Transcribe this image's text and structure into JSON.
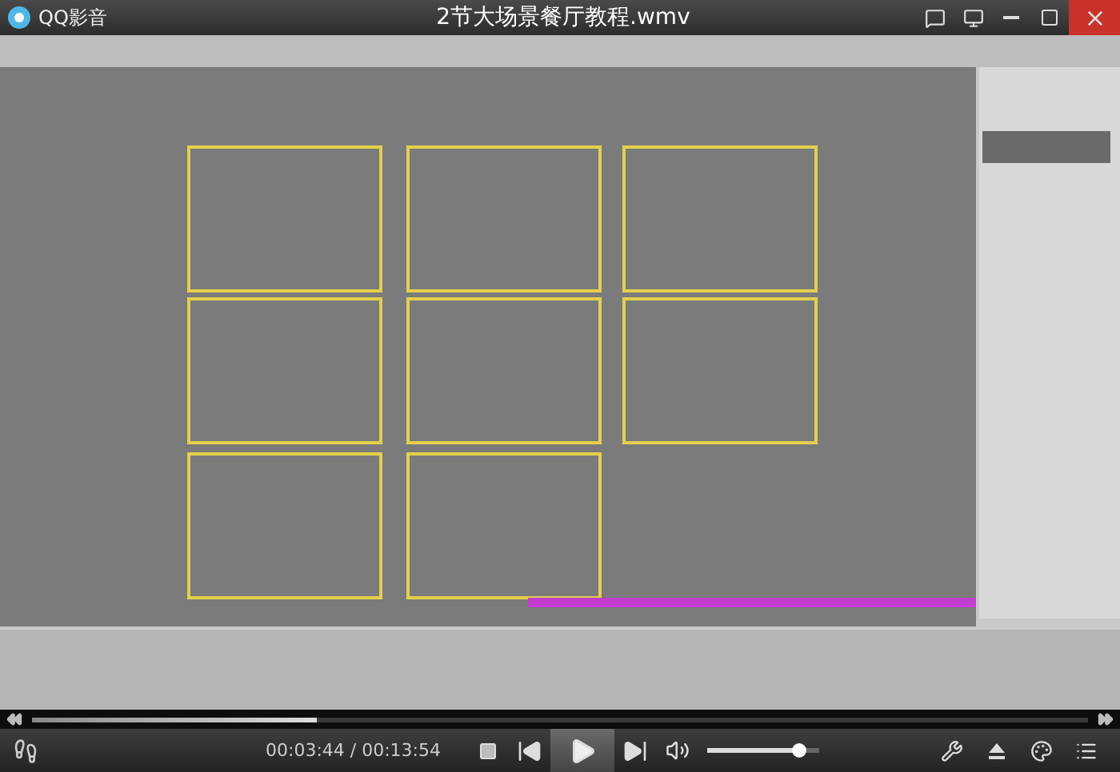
{
  "app": {
    "name": "QQ影音"
  },
  "window": {
    "title": "2节大场景餐厅教程.wmv"
  },
  "seek_bar": {
    "level": 0.27
  },
  "player": {
    "time": "00:03:44 / 00:13:54",
    "volume": {
      "level": 0.82
    }
  }
}
